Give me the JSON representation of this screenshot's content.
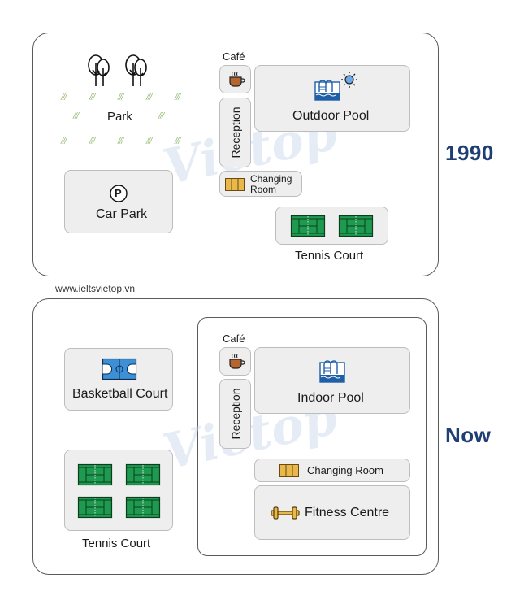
{
  "website": "www.ieltsvietop.vn",
  "watermark": "Vietop",
  "colors": {
    "year_label": "#1f3e74",
    "box_fill": "#eeeeee",
    "tennis_green": "#1e9a50",
    "pool_blue": "#1e5fa8",
    "basketball_blue": "#3d8fd6",
    "cafe_brown": "#b5652d",
    "gold": "#e8b84a"
  },
  "maps": [
    {
      "year": "1990",
      "facilities": {
        "park": {
          "label": "Park",
          "icon": "tree-icon",
          "tree_count": 2
        },
        "car_park": {
          "label": "Car Park",
          "icon": "parking-icon",
          "icon_glyph": "P"
        },
        "cafe": {
          "label": "Café",
          "icon": "coffee-cup-icon"
        },
        "reception": {
          "label": "Reception"
        },
        "outdoor_pool": {
          "label": "Outdoor Pool",
          "icon": "pool-sun-icon"
        },
        "changing_room": {
          "label_line1": "Changing",
          "label_line2": "Room",
          "icon": "lockers-icon"
        },
        "tennis_court": {
          "label": "Tennis Court",
          "icon": "tennis-court-icon",
          "court_count": 2
        }
      }
    },
    {
      "year": "Now",
      "facilities": {
        "basketball_court": {
          "label": "Basketball Court",
          "icon": "basketball-court-icon"
        },
        "tennis_court": {
          "label": "Tennis Court",
          "icon": "tennis-court-icon",
          "court_count": 4
        },
        "cafe": {
          "label": "Café",
          "icon": "coffee-cup-icon"
        },
        "reception": {
          "label": "Reception"
        },
        "indoor_pool": {
          "label": "Indoor Pool",
          "icon": "pool-icon"
        },
        "changing_room": {
          "label": "Changing Room",
          "icon": "lockers-icon"
        },
        "fitness_centre": {
          "label": "Fitness Centre",
          "icon": "dumbbell-icon"
        }
      }
    }
  ]
}
